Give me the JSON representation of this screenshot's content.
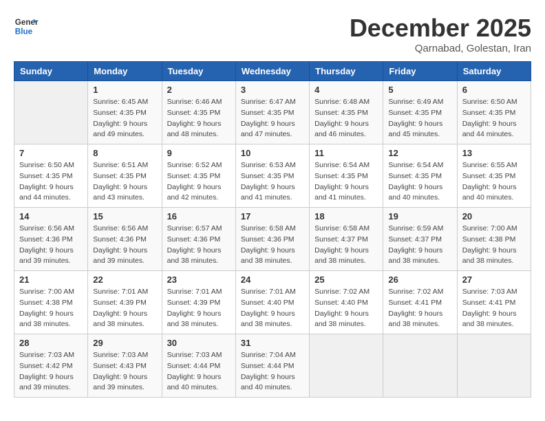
{
  "logo": {
    "line1": "General",
    "line2": "Blue"
  },
  "title": "December 2025",
  "subtitle": "Qarnabad, Golestan, Iran",
  "days_of_week": [
    "Sunday",
    "Monday",
    "Tuesday",
    "Wednesday",
    "Thursday",
    "Friday",
    "Saturday"
  ],
  "weeks": [
    [
      {
        "day": "",
        "info": ""
      },
      {
        "day": "1",
        "info": "Sunrise: 6:45 AM\nSunset: 4:35 PM\nDaylight: 9 hours\nand 49 minutes."
      },
      {
        "day": "2",
        "info": "Sunrise: 6:46 AM\nSunset: 4:35 PM\nDaylight: 9 hours\nand 48 minutes."
      },
      {
        "day": "3",
        "info": "Sunrise: 6:47 AM\nSunset: 4:35 PM\nDaylight: 9 hours\nand 47 minutes."
      },
      {
        "day": "4",
        "info": "Sunrise: 6:48 AM\nSunset: 4:35 PM\nDaylight: 9 hours\nand 46 minutes."
      },
      {
        "day": "5",
        "info": "Sunrise: 6:49 AM\nSunset: 4:35 PM\nDaylight: 9 hours\nand 45 minutes."
      },
      {
        "day": "6",
        "info": "Sunrise: 6:50 AM\nSunset: 4:35 PM\nDaylight: 9 hours\nand 44 minutes."
      }
    ],
    [
      {
        "day": "7",
        "info": "Sunrise: 6:50 AM\nSunset: 4:35 PM\nDaylight: 9 hours\nand 44 minutes."
      },
      {
        "day": "8",
        "info": "Sunrise: 6:51 AM\nSunset: 4:35 PM\nDaylight: 9 hours\nand 43 minutes."
      },
      {
        "day": "9",
        "info": "Sunrise: 6:52 AM\nSunset: 4:35 PM\nDaylight: 9 hours\nand 42 minutes."
      },
      {
        "day": "10",
        "info": "Sunrise: 6:53 AM\nSunset: 4:35 PM\nDaylight: 9 hours\nand 41 minutes."
      },
      {
        "day": "11",
        "info": "Sunrise: 6:54 AM\nSunset: 4:35 PM\nDaylight: 9 hours\nand 41 minutes."
      },
      {
        "day": "12",
        "info": "Sunrise: 6:54 AM\nSunset: 4:35 PM\nDaylight: 9 hours\nand 40 minutes."
      },
      {
        "day": "13",
        "info": "Sunrise: 6:55 AM\nSunset: 4:35 PM\nDaylight: 9 hours\nand 40 minutes."
      }
    ],
    [
      {
        "day": "14",
        "info": "Sunrise: 6:56 AM\nSunset: 4:36 PM\nDaylight: 9 hours\nand 39 minutes."
      },
      {
        "day": "15",
        "info": "Sunrise: 6:56 AM\nSunset: 4:36 PM\nDaylight: 9 hours\nand 39 minutes."
      },
      {
        "day": "16",
        "info": "Sunrise: 6:57 AM\nSunset: 4:36 PM\nDaylight: 9 hours\nand 38 minutes."
      },
      {
        "day": "17",
        "info": "Sunrise: 6:58 AM\nSunset: 4:36 PM\nDaylight: 9 hours\nand 38 minutes."
      },
      {
        "day": "18",
        "info": "Sunrise: 6:58 AM\nSunset: 4:37 PM\nDaylight: 9 hours\nand 38 minutes."
      },
      {
        "day": "19",
        "info": "Sunrise: 6:59 AM\nSunset: 4:37 PM\nDaylight: 9 hours\nand 38 minutes."
      },
      {
        "day": "20",
        "info": "Sunrise: 7:00 AM\nSunset: 4:38 PM\nDaylight: 9 hours\nand 38 minutes."
      }
    ],
    [
      {
        "day": "21",
        "info": "Sunrise: 7:00 AM\nSunset: 4:38 PM\nDaylight: 9 hours\nand 38 minutes."
      },
      {
        "day": "22",
        "info": "Sunrise: 7:01 AM\nSunset: 4:39 PM\nDaylight: 9 hours\nand 38 minutes."
      },
      {
        "day": "23",
        "info": "Sunrise: 7:01 AM\nSunset: 4:39 PM\nDaylight: 9 hours\nand 38 minutes."
      },
      {
        "day": "24",
        "info": "Sunrise: 7:01 AM\nSunset: 4:40 PM\nDaylight: 9 hours\nand 38 minutes."
      },
      {
        "day": "25",
        "info": "Sunrise: 7:02 AM\nSunset: 4:40 PM\nDaylight: 9 hours\nand 38 minutes."
      },
      {
        "day": "26",
        "info": "Sunrise: 7:02 AM\nSunset: 4:41 PM\nDaylight: 9 hours\nand 38 minutes."
      },
      {
        "day": "27",
        "info": "Sunrise: 7:03 AM\nSunset: 4:41 PM\nDaylight: 9 hours\nand 38 minutes."
      }
    ],
    [
      {
        "day": "28",
        "info": "Sunrise: 7:03 AM\nSunset: 4:42 PM\nDaylight: 9 hours\nand 39 minutes."
      },
      {
        "day": "29",
        "info": "Sunrise: 7:03 AM\nSunset: 4:43 PM\nDaylight: 9 hours\nand 39 minutes."
      },
      {
        "day": "30",
        "info": "Sunrise: 7:03 AM\nSunset: 4:44 PM\nDaylight: 9 hours\nand 40 minutes."
      },
      {
        "day": "31",
        "info": "Sunrise: 7:04 AM\nSunset: 4:44 PM\nDaylight: 9 hours\nand 40 minutes."
      },
      {
        "day": "",
        "info": ""
      },
      {
        "day": "",
        "info": ""
      },
      {
        "day": "",
        "info": ""
      }
    ]
  ]
}
